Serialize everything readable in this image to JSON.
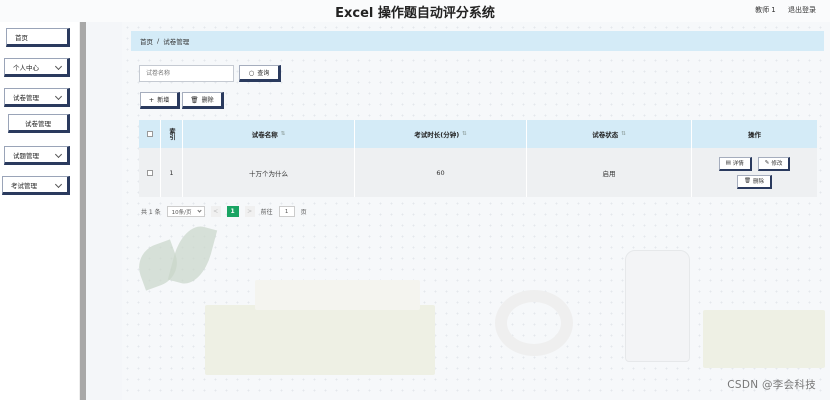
{
  "app": {
    "title": "Excel 操作题自动评分系统",
    "user": "教师 1",
    "logout": "退出登录"
  },
  "sidebar": {
    "items": [
      {
        "label": "首页"
      },
      {
        "label": "个人中心"
      },
      {
        "label": "试卷管理"
      },
      {
        "label": "试卷管理"
      },
      {
        "label": "试题管理"
      },
      {
        "label": "考试管理"
      }
    ]
  },
  "breadcrumb": {
    "home": "首页",
    "separator": "/",
    "current": "试卷管理"
  },
  "search": {
    "placeholder": "试卷名称",
    "button": "查询"
  },
  "toolbar": {
    "add": "新增",
    "delete": "删除"
  },
  "table": {
    "headers": {
      "index": "索引",
      "name": "试卷名称",
      "duration": "考试时长(分钟)",
      "status": "试卷状态",
      "ops": "操作"
    },
    "rows": [
      {
        "index": "1",
        "name": "十万个为什么",
        "duration": "60",
        "status": "启用",
        "ops": {
          "detail": "详情",
          "edit": "修改",
          "delete": "删除"
        }
      }
    ]
  },
  "pagination": {
    "total": "共 1 条",
    "page_size": "10条/页",
    "prev": "<",
    "current_page": "1",
    "next": ">",
    "goto_label": "前往",
    "goto_value": "1",
    "page_suffix": "页"
  },
  "watermark": "CSDN @李会科技",
  "colors": {
    "header_bg": "#d4ebf7",
    "active_page": "#19a463",
    "button_border": "#2a3a5e"
  }
}
